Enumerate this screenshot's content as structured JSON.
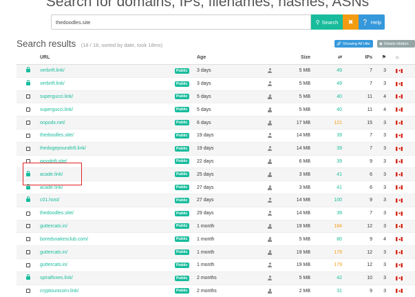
{
  "title": "Search for domains, IPs, filenames, hashes, ASNs",
  "search": {
    "value": "thedoodles.site",
    "search_label": "Search",
    "clear_label": "✖",
    "help_label": "Help"
  },
  "results": {
    "title": "Search results",
    "meta": "(18 / 18, sorted by date, took 18ms)",
    "show_all_label": "Showing All Hits",
    "details_label": "Details Hidden"
  },
  "columns": {
    "url": "URL",
    "age": "Age",
    "size": "Size",
    "ips": "IPs"
  },
  "colors": {
    "accent": "#18bc9c",
    "orange": "#f39c12",
    "blue": "#3498db",
    "highlight": "#e02020"
  },
  "rows": [
    {
      "icon": "lock",
      "url": "verbnft.link/",
      "badge": "Public",
      "age": "3 days",
      "size": "5 MB",
      "req": "49",
      "req_color": "green",
      "ips": "7",
      "countries": "3"
    },
    {
      "icon": "lock",
      "url": "verbnft.link/",
      "badge": "Public",
      "age": "3 days",
      "size": "5 MB",
      "req": "49",
      "req_color": "green",
      "ips": "7",
      "countries": "3"
    },
    {
      "icon": "box",
      "url": "supergucci.link/",
      "badge": "Public",
      "age": "5 days",
      "size": "5 MB",
      "req": "40",
      "req_color": "green",
      "ips": "11",
      "countries": "4"
    },
    {
      "icon": "box",
      "url": "supergucci.link/",
      "badge": "Public",
      "age": "5 days",
      "size": "5 MB",
      "req": "40",
      "req_color": "green",
      "ips": "11",
      "countries": "4"
    },
    {
      "icon": "box",
      "url": "onpodx.net/",
      "badge": "Public",
      "age": "6 days",
      "size": "17 MB",
      "req": "121",
      "req_color": "orange",
      "ips": "15",
      "countries": "3"
    },
    {
      "icon": "box",
      "url": "thedoodles.site/",
      "badge": "Public",
      "age": "19 days",
      "size": "14 MB",
      "req": "39",
      "req_color": "green",
      "ips": "7",
      "countries": "3"
    },
    {
      "icon": "box",
      "url": "thedogepoundnft.link/",
      "badge": "Public",
      "age": "19 days",
      "size": "14 MB",
      "req": "39",
      "req_color": "green",
      "ips": "7",
      "countries": "3"
    },
    {
      "icon": "box",
      "url": "woodnft.site/",
      "badge": "Public",
      "age": "22 days",
      "size": "6 MB",
      "req": "39",
      "req_color": "green",
      "ips": "9",
      "countries": "3"
    },
    {
      "icon": "lock",
      "url": "acade.link/",
      "badge": "Public",
      "age": "25 days",
      "size": "3 MB",
      "req": "41",
      "req_color": "green",
      "ips": "6",
      "countries": "3"
    },
    {
      "icon": "lock",
      "url": "acade.link/",
      "badge": "Public",
      "age": "27 days",
      "size": "3 MB",
      "req": "41",
      "req_color": "green",
      "ips": "6",
      "countries": "3"
    },
    {
      "icon": "lock",
      "url": "c01.host/",
      "badge": "Public",
      "age": "27 days",
      "size": "14 MB",
      "req": "100",
      "req_color": "green",
      "ips": "9",
      "countries": "3"
    },
    {
      "icon": "box",
      "url": "thedoodles.site/",
      "badge": "Public",
      "age": "29 days",
      "size": "14 MB",
      "req": "39",
      "req_color": "green",
      "ips": "7",
      "countries": "3"
    },
    {
      "icon": "box",
      "url": "guttercats.in/",
      "badge": "Public",
      "age": "1 month",
      "size": "19 MB",
      "req": "184",
      "req_color": "orange",
      "ips": "12",
      "countries": "3"
    },
    {
      "icon": "box",
      "url": "boredsnakesclub.com/",
      "badge": "Public",
      "age": "1 month",
      "size": "5 MB",
      "req": "80",
      "req_color": "green",
      "ips": "9",
      "countries": "4"
    },
    {
      "icon": "box",
      "url": "guttercats.in/",
      "badge": "Public",
      "age": "1 month",
      "size": "19 MB",
      "req": "179",
      "req_color": "orange",
      "ips": "12",
      "countries": "3"
    },
    {
      "icon": "box",
      "url": "guttercats.in/",
      "badge": "Public",
      "age": "1 month",
      "size": "19 MB",
      "req": "179",
      "req_color": "orange",
      "ips": "12",
      "countries": "3"
    },
    {
      "icon": "lock",
      "url": "spiralfoxes.link/",
      "badge": "Public",
      "age": "2 months",
      "size": "5 MB",
      "req": "42",
      "req_color": "green",
      "ips": "10",
      "countries": "3"
    },
    {
      "icon": "box",
      "url": "cryptounicorn.link/",
      "badge": "Public",
      "age": "2 months",
      "size": "2 MB",
      "req": "31",
      "req_color": "green",
      "ips": "9",
      "countries": "3"
    }
  ]
}
